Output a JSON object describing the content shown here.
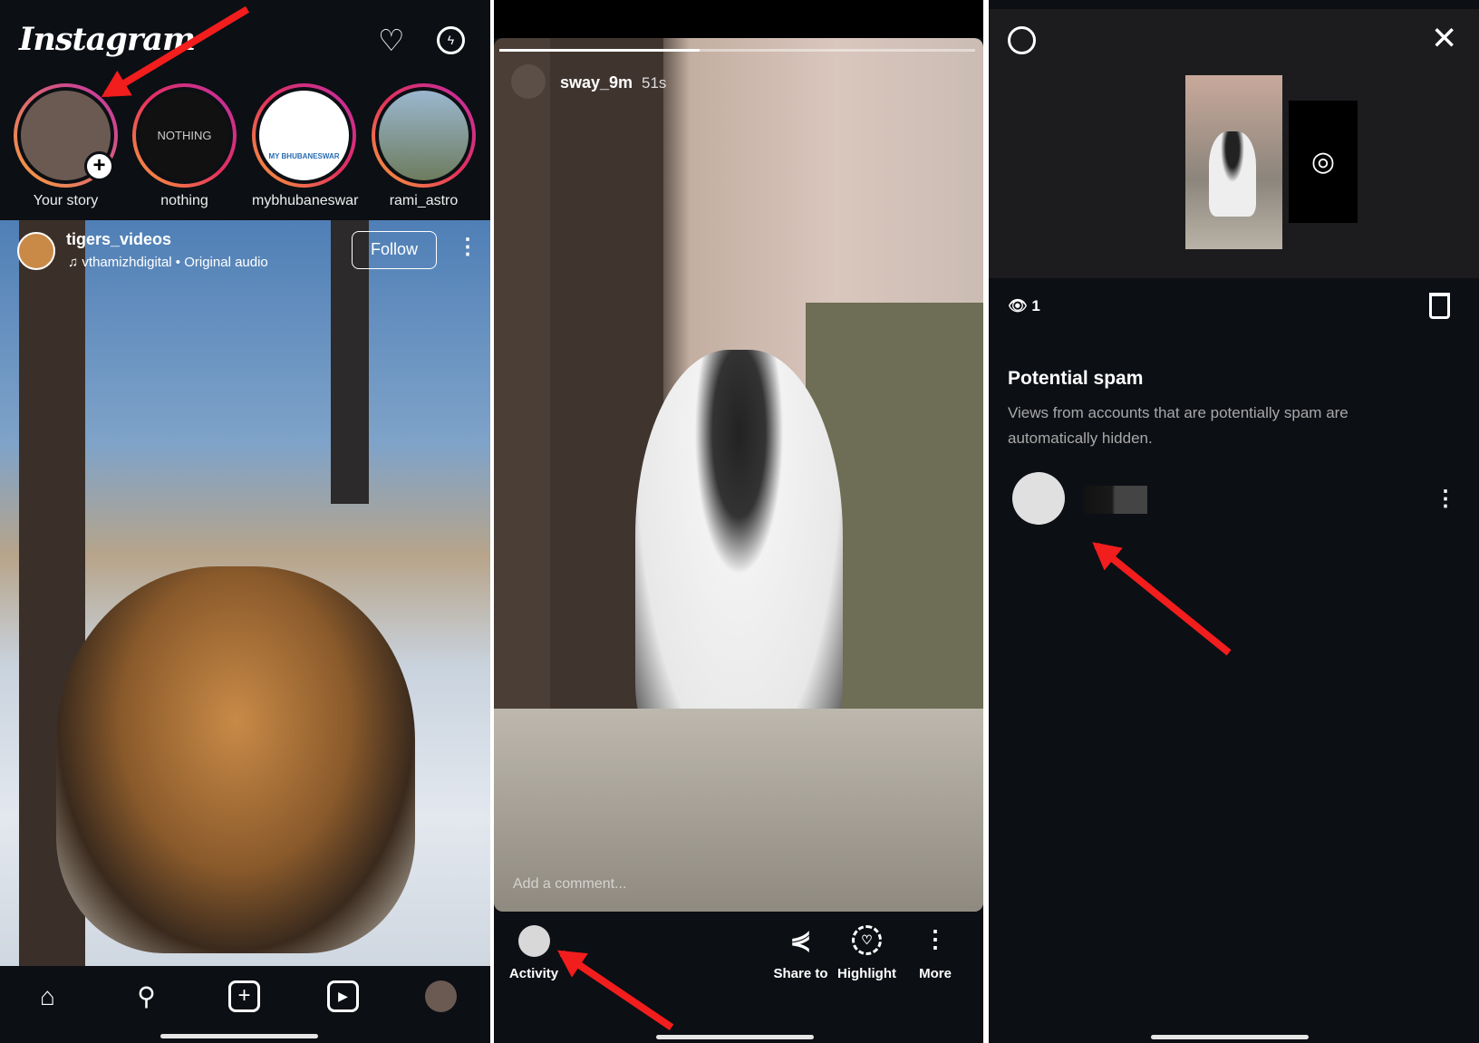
{
  "feed": {
    "app_title": "Instagram",
    "stories": [
      {
        "label": "Your story"
      },
      {
        "label": "nothing",
        "inner": "NOTHING"
      },
      {
        "label": "mybhubaneswar",
        "inner": "MY BHUBANESWAR"
      },
      {
        "label": "rami_astro"
      }
    ],
    "post": {
      "username": "tigers_videos",
      "audio": "vthamizhdigital • Original audio",
      "follow_label": "Follow"
    },
    "nav": [
      "home",
      "search",
      "create",
      "reels",
      "profile"
    ]
  },
  "story_view": {
    "username": "sway_9m",
    "time": "51s",
    "progress": 0.42,
    "comment_placeholder": "Add a comment...",
    "actions": {
      "activity": "Activity",
      "share": "Share to",
      "highlight": "Highlight",
      "more": "More"
    }
  },
  "activity": {
    "view_count": "1",
    "section_title": "Potential spam",
    "section_desc": "Views from accounts that are potentially spam are automatically hidden."
  },
  "colors": {
    "background": "#0c0f14",
    "annotation_arrow": "#f21d1d"
  }
}
